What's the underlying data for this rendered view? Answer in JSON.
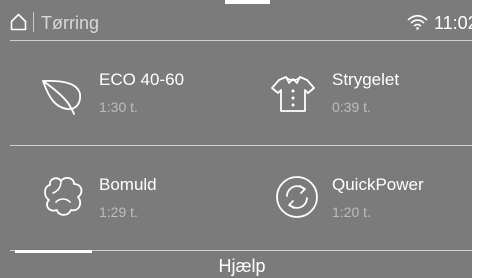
{
  "status_bar": {
    "title": "Tørring",
    "time": "11:02",
    "home_icon": "home-icon",
    "wifi_icon": "wifi-icon"
  },
  "programs": [
    {
      "name": "ECO 40-60",
      "duration": "1:30  t.",
      "icon": "leaf-icon"
    },
    {
      "name": "Strygelet",
      "duration": "0:39  t.",
      "icon": "shirt-icon"
    },
    {
      "name": "Bomuld",
      "duration": "1:29  t.",
      "icon": "cotton-icon"
    },
    {
      "name": "QuickPower",
      "duration": "1:20  t.",
      "icon": "quickpower-icon"
    }
  ],
  "footer": {
    "help_label": "Hjælp"
  },
  "colors": {
    "background": "#7b7b7b",
    "text": "#ffffff",
    "secondary_text": "#bdbdbd",
    "divider": "#cfcfcf"
  }
}
